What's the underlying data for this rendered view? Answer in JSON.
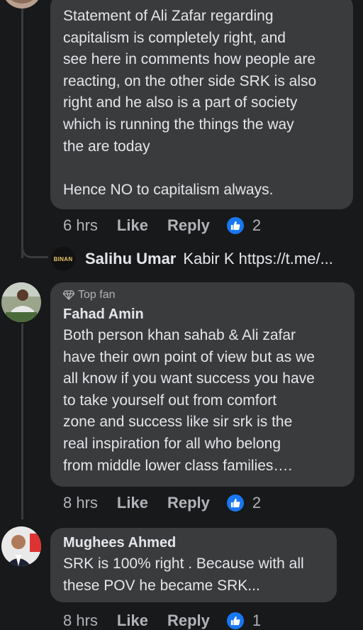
{
  "comments": [
    {
      "text": "Statement of Ali Zafar regarding\ncapitalism is completely right, and\nsee here in comments how people are\nreacting, on the other side SRK is also\nright and he also is a part of society\nwhich is running the things the way\nthe are today\n\nHence NO to capitalism always.",
      "time": "6 hrs",
      "like": "Like",
      "reply": "Reply",
      "reactions": "2"
    },
    {
      "badge": "Top fan",
      "author": "Fahad Amin",
      "text": "Both person khan sahab & Ali zafar\nhave their own point of view but as we\nall know if you want success you have\nto take yourself out from comfort\nzone and success like sir srk is the\nreal inspiration for all who belong\nfrom middle lower class families….",
      "time": "8 hrs",
      "like": "Like",
      "reply": "Reply",
      "reactions": "2"
    },
    {
      "author": "Mughees Ahmed",
      "text": "SRK is 100% right . Because with all\nthese POV he became SRK...",
      "time": "8 hrs",
      "like": "Like",
      "reply": "Reply",
      "reactions": "1"
    }
  ],
  "reply_preview": {
    "avatar_text": "BINAN",
    "author": "Salihu Umar",
    "text": "Kabir K https://t.me/..."
  },
  "icons": {
    "like_reaction": "thumbs-up-icon",
    "top_fan": "diamond-icon"
  },
  "colors": {
    "background": "#18191a",
    "bubble": "#3a3b3c",
    "like_blue": "#1877f2"
  }
}
